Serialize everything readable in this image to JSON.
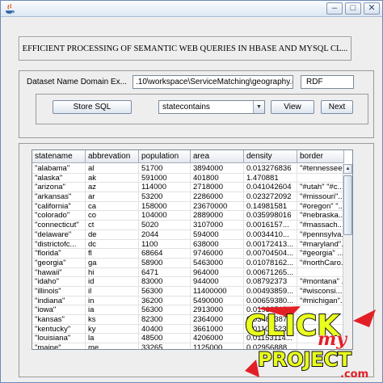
{
  "window": {
    "title": "",
    "controls": {
      "minimize": "‒",
      "maximize": "□",
      "close": "✕"
    }
  },
  "header": {
    "title": "EFFICIENT PROCESSING OF SEMANTIC WEB QUERIES IN HBASE AND MYSQL CL..."
  },
  "dataset": {
    "label": "Dataset Name  Domain Ex...",
    "path": ".10\\workspace\\ServiceMatching\\geography.owl",
    "format": "RDF"
  },
  "controls": {
    "store_sql": "Store SQL",
    "selected_property": "statecontains",
    "view": "View",
    "next": "Next"
  },
  "table": {
    "columns": [
      "statename",
      "abbrevation",
      "population",
      "area",
      "density",
      "border"
    ],
    "rows": [
      [
        "\"alabama\"",
        "al",
        "51700",
        "3894000",
        "0.013276836",
        "\"#tennessee..."
      ],
      [
        "\"alaska\"",
        "ak",
        "591000",
        "401800",
        "1.470881",
        ""
      ],
      [
        "\"arizona\"",
        "az",
        "114000",
        "2718000",
        "0.041042604",
        "\"#utah\" \"#c..."
      ],
      [
        "\"arkansas\"",
        "ar",
        "53200",
        "2286000",
        "0.023272092",
        "\"#missouri\"..."
      ],
      [
        "\"california\"",
        "ca",
        "158000",
        "23670000",
        "0.14981581",
        "\"#oregon\" \"..."
      ],
      [
        "\"colorado\"",
        "co",
        "104000",
        "2889000",
        "0.035998016",
        "\"#nebraska..."
      ],
      [
        "\"connecticut\"",
        "ct",
        "5020",
        "3107000",
        "0.0016157...",
        "\"#massach..."
      ],
      [
        "\"delaware\"",
        "de",
        "2044",
        "594000",
        "0.0034410...",
        "\"#pennsylva..."
      ],
      [
        "\"districtofc...",
        "dc",
        "1100",
        "638000",
        "0.00172413...",
        "\"#maryland\"..."
      ],
      [
        "\"florida\"",
        "fl",
        "68664",
        "9746000",
        "0.00704504...",
        "\"#georgia\" ..."
      ],
      [
        "\"georgia\"",
        "ga",
        "58900",
        "5463000",
        "0.01078162...",
        "\"#northCaro..."
      ],
      [
        "\"hawaii\"",
        "hi",
        "6471",
        "964000",
        "0.00671265...",
        ""
      ],
      [
        "\"idaho\"",
        "id",
        "83000",
        "944000",
        "0.08792373",
        "\"#montana\" ..."
      ],
      [
        "\"illinois\"",
        "il",
        "56300",
        "11400000",
        "0.00493859...",
        "\"#wisconsi..."
      ],
      [
        "\"indiana\"",
        "in",
        "36200",
        "5490000",
        "0.00659380...",
        "\"#michigan\"..."
      ],
      [
        "\"iowa\"",
        "ia",
        "56300",
        "2913000",
        "0.01932715...",
        ""
      ],
      [
        "\"kansas\"",
        "ks",
        "82300",
        "2364000",
        "0.03481387...",
        ""
      ],
      [
        "\"kentucky\"",
        "ky",
        "40400",
        "3661000",
        "0.01103523...",
        ""
      ],
      [
        "\"louisiana\"",
        "la",
        "48500",
        "4206000",
        "0.01153114...",
        ""
      ],
      [
        "\"maine\"",
        "me",
        "33265",
        "1125000",
        "0.02956888...",
        ""
      ]
    ]
  },
  "watermark": {
    "line1": "CLICK",
    "script": "my",
    "line2": "PROJECT",
    "suffix": ".com"
  },
  "colors": {
    "window_bg": "#eeeeee",
    "watermark_yellow": "#e9ff1d",
    "watermark_red": "#e31f26",
    "watermark_black": "#111111"
  }
}
